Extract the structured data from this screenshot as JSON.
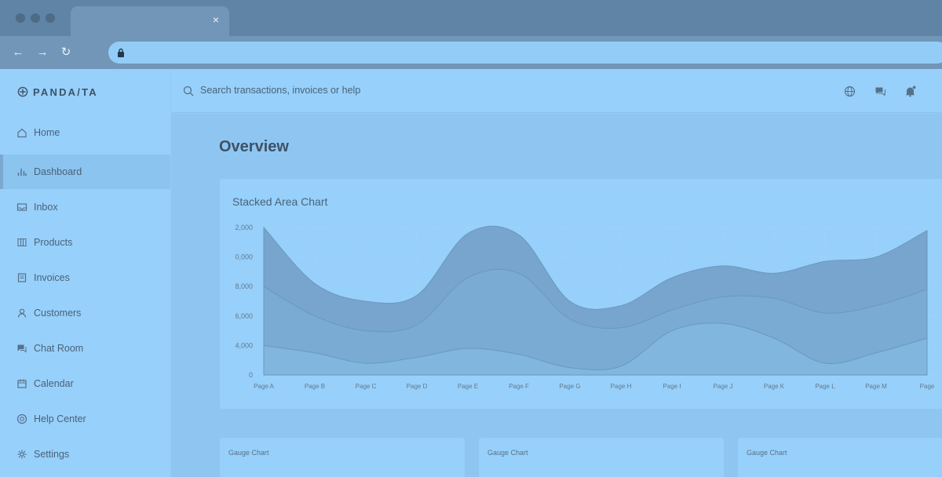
{
  "browser": {
    "tab_close": "×",
    "nav": {
      "back": "←",
      "forward": "→",
      "reload": "↻"
    }
  },
  "brand": {
    "name": "PANDA/TA"
  },
  "sidebar": {
    "items": [
      {
        "label": "Home",
        "icon": "home-icon"
      },
      {
        "label": "Dashboard",
        "icon": "bar-chart-icon",
        "active": true
      },
      {
        "label": "Inbox",
        "icon": "inbox-icon"
      },
      {
        "label": "Products",
        "icon": "products-icon"
      },
      {
        "label": "Invoices",
        "icon": "invoice-icon"
      },
      {
        "label": "Customers",
        "icon": "user-icon"
      },
      {
        "label": "Chat Room",
        "icon": "chat-icon"
      },
      {
        "label": "Calendar",
        "icon": "calendar-icon"
      },
      {
        "label": "Help Center",
        "icon": "help-icon"
      },
      {
        "label": "Settings",
        "icon": "gear-icon"
      }
    ]
  },
  "header": {
    "search_placeholder": "Search transactions, invoices or help",
    "icons": [
      "globe-icon",
      "chat-icon",
      "bell-icon"
    ]
  },
  "main": {
    "title": "Overview",
    "gauges": [
      {
        "title": "Gauge Chart"
      },
      {
        "title": "Gauge Chart"
      },
      {
        "title": "Gauge Chart"
      }
    ]
  },
  "chart_data": {
    "type": "area",
    "stacked": true,
    "title": "Stacked Area Chart",
    "categories": [
      "Page A",
      "Page B",
      "Page C",
      "Page D",
      "Page E",
      "Page F",
      "Page G",
      "Page H",
      "Page I",
      "Page J",
      "Page K",
      "Page L",
      "Page M",
      "Page N"
    ],
    "category_labels": [
      "Page A",
      "Page B",
      "Page C",
      "Page D",
      "Page E",
      "Page F",
      "Page G",
      "Page H",
      "Page I",
      "Page J",
      "Page K",
      "Page L",
      "Page M",
      "Page"
    ],
    "y_tick_labels": [
      "2,000",
      "0,000",
      "8,000",
      "6,000",
      "4,000",
      "0"
    ],
    "ylim": [
      0,
      10000
    ],
    "series": [
      {
        "values": [
          2000,
          1500,
          800,
          1200,
          1800,
          1400,
          500,
          600,
          3000,
          3500,
          2500,
          800,
          1500,
          2500
        ]
      },
      {
        "values": [
          4000,
          2500,
          2200,
          2200,
          4800,
          5500,
          3300,
          2600,
          1400,
          1800,
          2700,
          3400,
          3200,
          3300
        ]
      },
      {
        "values": [
          4000,
          2200,
          2000,
          2000,
          3000,
          2600,
          1200,
          1500,
          2200,
          2100,
          1700,
          3500,
          3300,
          4000
        ]
      }
    ],
    "colors": {
      "series0": "#83b7e1",
      "series1": "#7aabd3",
      "series2": "#719ec6",
      "gridline": "#a3d4f7",
      "tick_text": "#62798f"
    },
    "grid": true,
    "legend": false
  }
}
